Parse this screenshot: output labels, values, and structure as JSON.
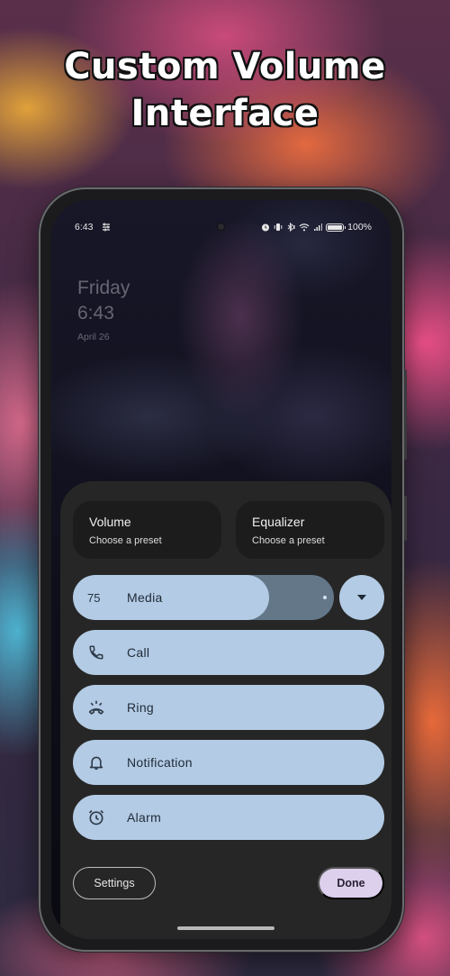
{
  "promo": {
    "headline_line1": "Custom Volume",
    "headline_line2": "Interface"
  },
  "status_bar": {
    "time": "6:43",
    "left_icons": [
      "equalizer-settings-icon"
    ],
    "right_icons": [
      "alarm-icon",
      "vibrate-icon",
      "bluetooth-icon",
      "wifi-icon",
      "signal-icon",
      "battery-icon"
    ],
    "battery_percent": "100%",
    "battery_level": 1.0
  },
  "lockscreen": {
    "day": "Friday",
    "time": "6:43",
    "date": "April 26"
  },
  "presets": [
    {
      "title": "Volume",
      "subtitle": "Choose a preset"
    },
    {
      "title": "Equalizer",
      "subtitle": "Choose a preset"
    }
  ],
  "sliders": [
    {
      "id": "media",
      "label": "Media",
      "value": "75",
      "icon": "",
      "level": 0.75
    },
    {
      "id": "call",
      "label": "Call",
      "icon": "phone-icon",
      "level": 1.0
    },
    {
      "id": "ring",
      "label": "Ring",
      "icon": "ringing-phone-icon",
      "level": 1.0
    },
    {
      "id": "notification",
      "label": "Notification",
      "icon": "bell-icon",
      "level": 1.0
    },
    {
      "id": "alarm",
      "label": "Alarm",
      "icon": "alarm-clock-icon",
      "level": 1.0
    }
  ],
  "expand_button": {
    "icon": "caret-down-icon"
  },
  "footer": {
    "settings_label": "Settings",
    "done_label": "Done"
  },
  "colors": {
    "slider_fill": "#b3cbe4",
    "slider_track": "#637789",
    "panel_bg": "#262626",
    "preset_bg": "#1c1c1c",
    "done_bg": "#dcd0ec"
  }
}
